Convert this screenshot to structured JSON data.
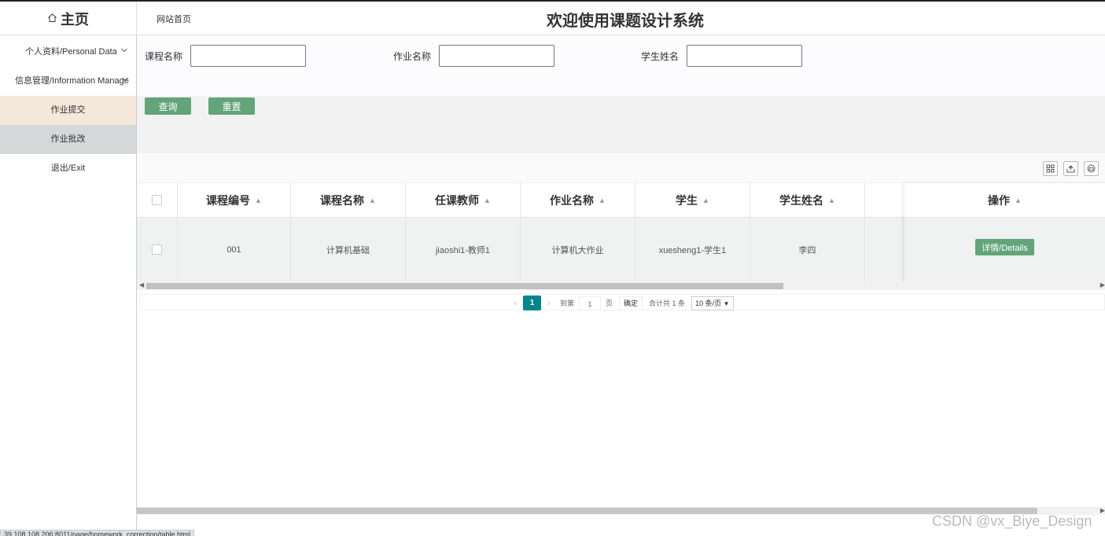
{
  "header": {
    "brand": "主页",
    "site_link": "网站首页",
    "title": "欢迎使用课题设计系统"
  },
  "sidebar": {
    "groups": [
      {
        "label": "个人资料/Personal Data"
      },
      {
        "label": "信息管理/Information Manage"
      }
    ],
    "sub_items": [
      {
        "label": "作业提交"
      },
      {
        "label": "作业批改"
      }
    ],
    "exit": "退出/Exit"
  },
  "search": {
    "fields": [
      {
        "label": "课程名称",
        "value": ""
      },
      {
        "label": "作业名称",
        "value": ""
      },
      {
        "label": "学生姓名",
        "value": ""
      }
    ],
    "query_label": "查询",
    "reset_label": "重置"
  },
  "table": {
    "columns": [
      "课程编号",
      "课程名称",
      "任课教师",
      "作业名称",
      "学生",
      "学生姓名"
    ],
    "action_column": "操作",
    "rows": [
      {
        "cells": [
          "001",
          "计算机基础",
          "jiaoshi1-教师1",
          "计算机大作业",
          "xuesheng1-学生1",
          "李四"
        ],
        "action_label": "详情/Details"
      }
    ]
  },
  "pagination": {
    "current_page": "1",
    "goto_prefix": "到第",
    "goto_value": "1",
    "goto_suffix": "页",
    "confirm": "确定",
    "total": "合计共 1 条",
    "page_size": "10 条/页"
  },
  "status_url": "39.108.108.206:8011/page/homework_correction/table.html",
  "watermark": "CSDN @vx_Biye_Design",
  "colors": {
    "primary_button": "#62a57a",
    "active_page": "#00868b",
    "active_menu": "#f3e8d9"
  }
}
